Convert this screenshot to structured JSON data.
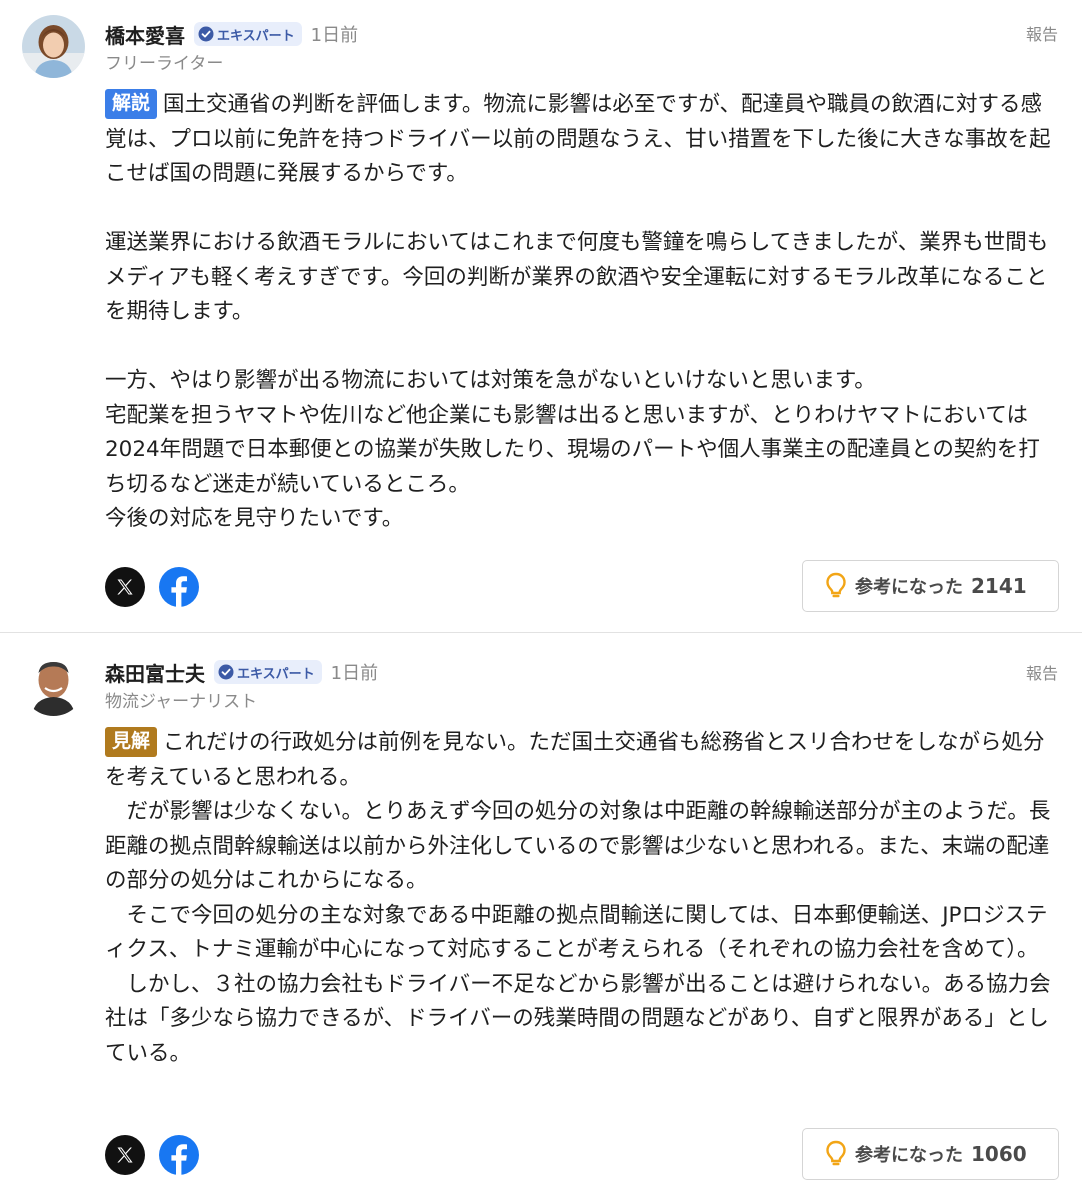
{
  "comments": [
    {
      "name": "橋本愛喜",
      "badge": "エキスパート",
      "time": "1日前",
      "role": "フリーライター",
      "report": "報告",
      "tag": "解説",
      "tag_color": "#3b7ee8",
      "paragraphs": [
        "国土交通省の判断を評価します。物流に影響は必至ですが、配達員や職員の飲酒に対する感覚は、プロ以前に免許を持つドライバー以前の問題なうえ、甘い措置を下した後に大きな事故を起こせば国の問題に発展するからです。",
        "運送業界における飲酒モラルにおいてはこれまで何度も警鐘を鳴らしてきましたが、業界も世間もメディアも軽く考えすぎです。今回の判断が業界の飲酒や安全運転に対するモラル改革になることを期待します。",
        "一方、やはり影響が出る物流においては対策を急がないといけないと思います。",
        "宅配業を担うヤマトや佐川など他企業にも影響は出ると思いますが、とりわけヤマトにおいては2024年問題で日本郵便との協業が失敗したり、現場のパートや個人事業主の配達員との契約を打ち切るなど迷走が続いているところ。",
        "今後の対応を見守りたいです。"
      ],
      "share": {
        "x_icon": "x-logo-icon",
        "facebook_icon": "facebook-icon"
      },
      "useful_label": "参考になった",
      "useful_count": "2141"
    },
    {
      "name": "森田富士夫",
      "badge": "エキスパート",
      "time": "1日前",
      "role": "物流ジャーナリスト",
      "report": "報告",
      "tag": "見解",
      "tag_color": "#b07a1e",
      "paragraphs": [
        "これだけの行政処分は前例を見ない。ただ国土交通省も総務省とスリ合わせをしながら処分を考えていると思われる。",
        "だが影響は少なくない。とりあえず今回の処分の対象は中距離の幹線輸送部分が主のようだ。長距離の拠点間幹線輸送は以前から外注化しているので影響は少ないと思われる。また、末端の配達の部分の処分はこれからになる。",
        "そこで今回の処分の主な対象である中距離の拠点間輸送に関しては、日本郵便輸送、JPロジスティクス、トナミ運輸が中心になって対応することが考えられる（それぞれの協力会社を含めて）。",
        "しかし、３社の協力会社もドライバー不足などから影響が出ることは避けられない。ある協力会社は「多少なら協力できるが、ドライバーの残業時間の問題などがあり、自ずと限界がある」としている。"
      ],
      "share": {
        "x_icon": "x-logo-icon",
        "facebook_icon": "facebook-icon"
      },
      "useful_label": "参考になった",
      "useful_count": "1060"
    }
  ]
}
